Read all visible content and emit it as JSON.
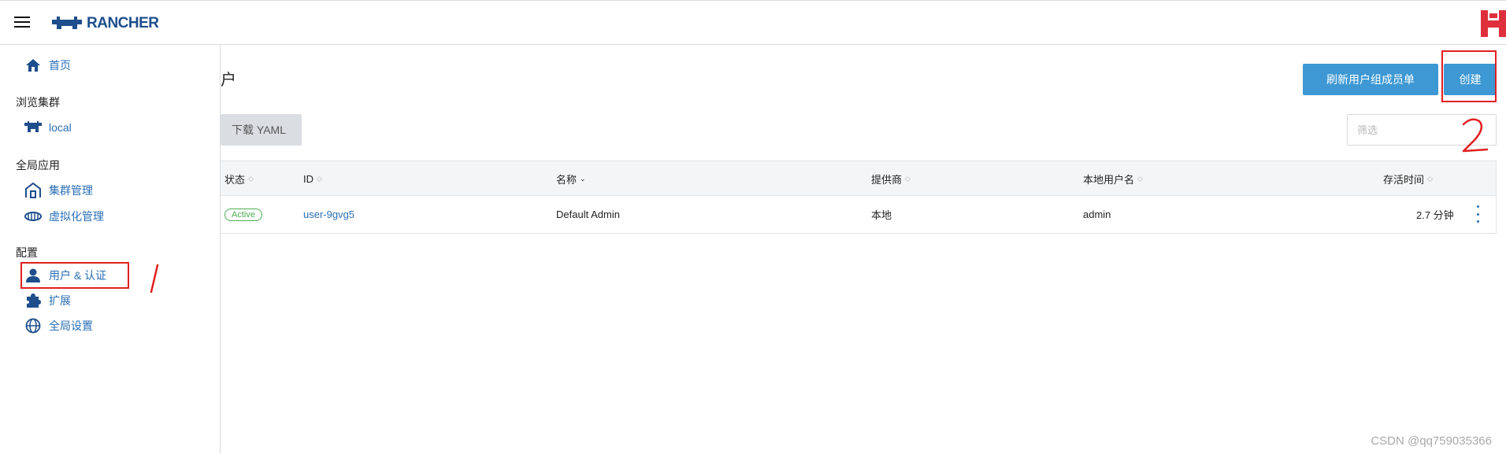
{
  "header": {
    "logo_text": "RANCHER",
    "brand_color": "#1e4e8c"
  },
  "sidebar": {
    "home": {
      "label": "首页",
      "icon": "home-icon"
    },
    "explore_heading": "浏览集群",
    "cluster": {
      "label": "local",
      "icon": "cattle-icon"
    },
    "global_apps_heading": "全局应用",
    "global_apps": [
      {
        "label": "集群管理",
        "icon": "barn-icon"
      },
      {
        "label": "虚拟化管理",
        "icon": "harvester-icon"
      }
    ],
    "config_heading": "配置",
    "config_items": [
      {
        "label": "用户 & 认证",
        "icon": "user-icon"
      },
      {
        "label": "扩展",
        "icon": "puzzle-icon"
      },
      {
        "label": "全局设置",
        "icon": "globe-icon"
      }
    ]
  },
  "main": {
    "title_fragment": "户",
    "refresh_button": "刷新用户组成员单",
    "create_button": "创建",
    "download_yaml": "下载 YAML",
    "filter_placeholder": "筛选",
    "accent_color": "#3d98d3"
  },
  "table": {
    "columns": [
      "状态",
      "ID",
      "名称",
      "提供商",
      "本地用户名",
      "存活时间"
    ],
    "rows": [
      {
        "status": "Active",
        "id": "user-9gvg5",
        "name": "Default Admin",
        "provider": "本地",
        "username": "admin",
        "age": "2.7 分钟"
      }
    ]
  },
  "annotations": {
    "mark_1": "1",
    "mark_2": "2",
    "color": "#e02020"
  },
  "watermark": "CSDN @qq759035366"
}
